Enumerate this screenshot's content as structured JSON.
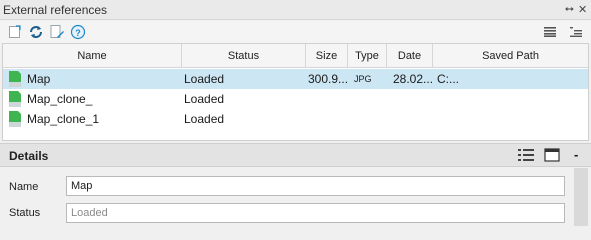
{
  "panel": {
    "title": "External references",
    "pin_glyph": "⭤",
    "close_glyph": "✕"
  },
  "toolbar": {
    "left_icons": [
      "attach-icon",
      "reload-icon",
      "edit-path-icon",
      "help-icon"
    ],
    "help_glyph": "?",
    "right_icons": [
      "list-view-icon",
      "tree-view-icon"
    ]
  },
  "table": {
    "columns": [
      "Name",
      "Status",
      "Size",
      "Type",
      "Date",
      "Saved Path"
    ],
    "rows": [
      {
        "name": "Map",
        "status": "Loaded",
        "size": "300.9...",
        "type": "JPG",
        "date": "28.02...",
        "saved_path": "C:...",
        "selected": true
      },
      {
        "name": "Map_clone_",
        "status": "Loaded",
        "size": "",
        "type": "",
        "date": "",
        "saved_path": "",
        "selected": false
      },
      {
        "name": "Map_clone_1",
        "status": "Loaded",
        "size": "",
        "type": "",
        "date": "",
        "saved_path": "",
        "selected": false
      }
    ]
  },
  "details": {
    "title": "Details",
    "icons": [
      "list-details-icon",
      "preview-icon",
      "collapse-icon"
    ],
    "collapse_glyph": "-",
    "name_label": "Name",
    "name_value": "Map",
    "status_label": "Status",
    "status_value": "Loaded"
  },
  "colors": {
    "selection": "#cde6f3",
    "accent": "#1e88c8",
    "file_icon_green": "#3fb551"
  }
}
